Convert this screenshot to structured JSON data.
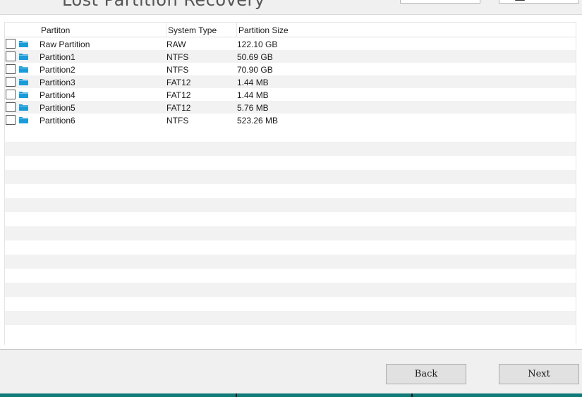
{
  "header": {
    "title": "Lost Partition Recovery"
  },
  "list": {
    "columns": {
      "name": "Partiton",
      "type": "System Type",
      "size": "Partition Size"
    },
    "rows": [
      {
        "name": "Raw Partition",
        "type": "RAW",
        "size": "122.10 GB",
        "checked": false,
        "icon": "folder-icon"
      },
      {
        "name": "Partition1",
        "type": "NTFS",
        "size": "50.69 GB",
        "checked": false,
        "icon": "folder-icon"
      },
      {
        "name": "Partition2",
        "type": "NTFS",
        "size": "70.90 GB",
        "checked": false,
        "icon": "folder-icon"
      },
      {
        "name": "Partition3",
        "type": "FAT12",
        "size": "1.44 MB",
        "checked": false,
        "icon": "folder-icon"
      },
      {
        "name": "Partition4",
        "type": "FAT12",
        "size": "1.44 MB",
        "checked": false,
        "icon": "folder-icon"
      },
      {
        "name": "Partition5",
        "type": "FAT12",
        "size": "5.76 MB",
        "checked": false,
        "icon": "folder-icon"
      },
      {
        "name": "Partition6",
        "type": "NTFS",
        "size": "523.26 MB",
        "checked": false,
        "icon": "folder-icon"
      }
    ]
  },
  "footer": {
    "back_label": "Back",
    "next_label": "Next"
  },
  "colors": {
    "folder": "#1b9bd7",
    "stripe": "#f2f2f2",
    "taskbar": "#0f7a78"
  }
}
